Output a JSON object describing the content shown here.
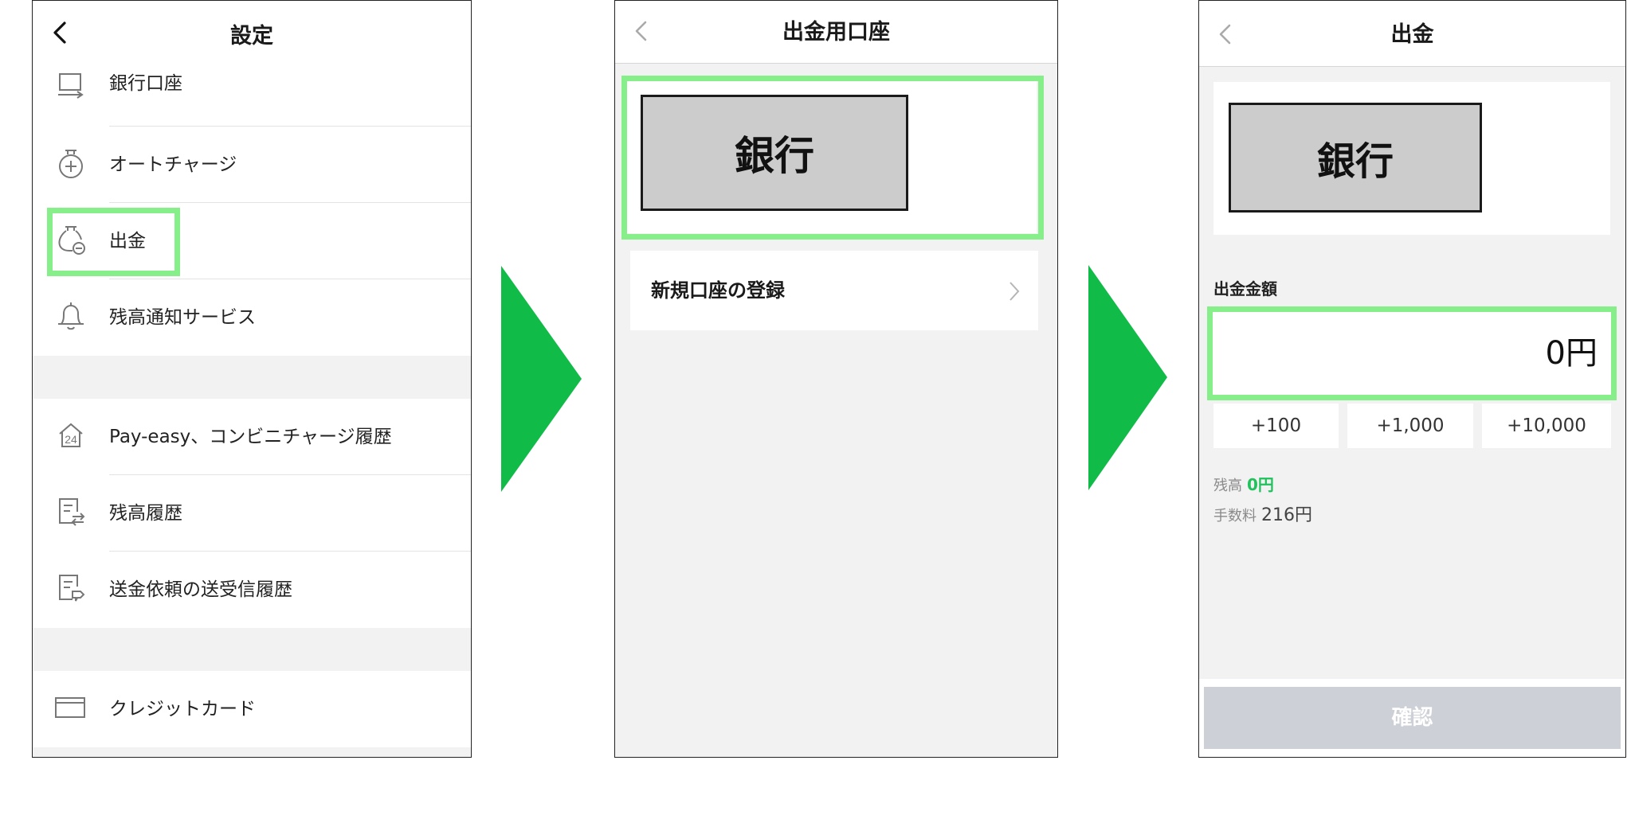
{
  "colors": {
    "highlight": "#86ef8a",
    "arrow": "#10bb48",
    "balance_green": "#22c15e",
    "disabled_button": "#cdd0d6"
  },
  "screen1": {
    "title": "設定",
    "items": [
      {
        "label": "銀行口座",
        "icon": "bank-transfer-icon"
      },
      {
        "label": "オートチャージ",
        "icon": "auto-charge-icon"
      },
      {
        "label": "出金",
        "icon": "withdraw-icon"
      },
      {
        "label": "残高通知サービス",
        "icon": "bell-icon"
      },
      {
        "label": "Pay-easy、コンビニチャージ履歴",
        "icon": "pay-easy-24-icon"
      },
      {
        "label": "残高履歴",
        "icon": "balance-history-icon"
      },
      {
        "label": "送金依頼の送受信履歴",
        "icon": "transfer-request-history-icon"
      },
      {
        "label": "クレジットカード",
        "icon": "credit-card-icon"
      }
    ]
  },
  "screen2": {
    "title": "出金用口座",
    "bank_label": "銀行",
    "new_account_label": "新規口座の登録"
  },
  "screen3": {
    "title": "出金",
    "bank_label": "銀行",
    "amount_label": "出金金額",
    "amount_value": "0円",
    "quick_buttons": [
      "+100",
      "+1,000",
      "+10,000"
    ],
    "balance_label": "残高",
    "balance_value": "0円",
    "fee_label": "手数料",
    "fee_value": "216円",
    "confirm_label": "確認"
  }
}
